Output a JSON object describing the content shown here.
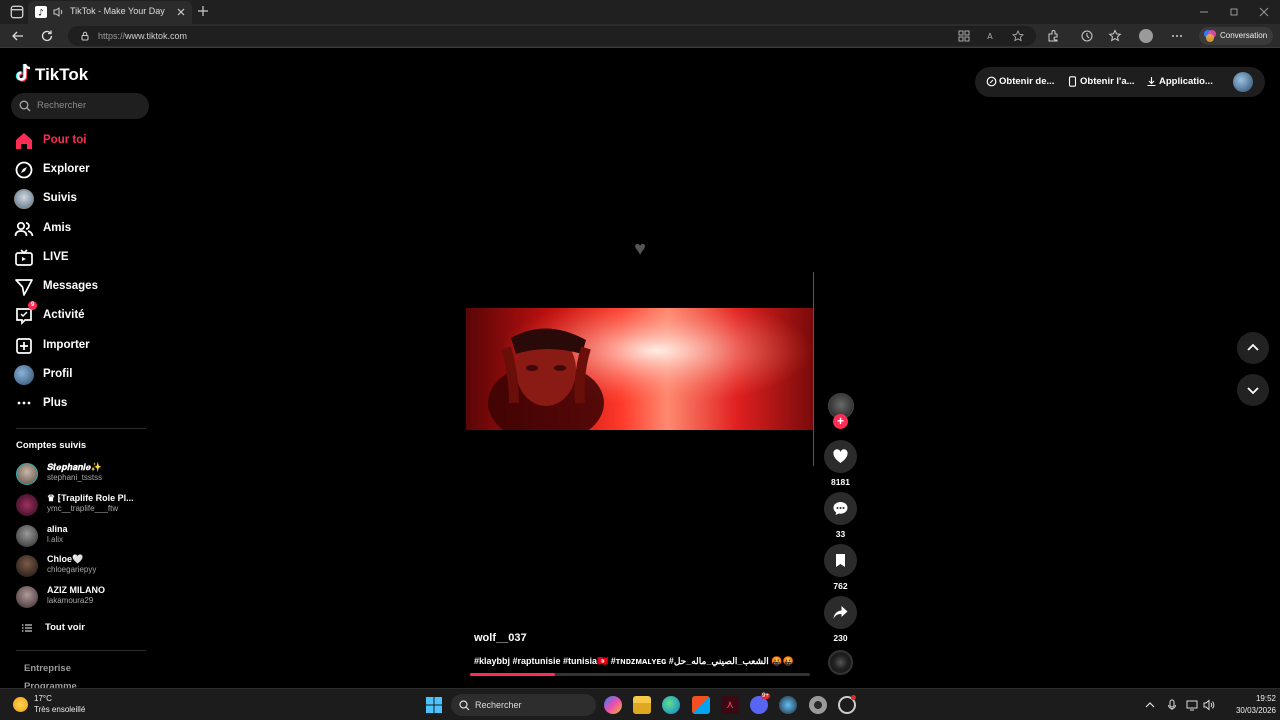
{
  "browser": {
    "tab_title": "TikTok - Make Your Day",
    "url_scheme": "https://",
    "url_host": "www.tiktok.com",
    "conversation_label": "Conversation"
  },
  "sidebar": {
    "logo": "TikTok",
    "search_placeholder": "Rechercher",
    "nav": [
      {
        "label": "Pour toi",
        "icon": "home-icon",
        "active": true
      },
      {
        "label": "Explorer",
        "icon": "compass-icon"
      },
      {
        "label": "Suivis",
        "icon": "following-avatar-icon"
      },
      {
        "label": "Amis",
        "icon": "friends-icon"
      },
      {
        "label": "LIVE",
        "icon": "live-tv-icon"
      },
      {
        "label": "Messages",
        "icon": "send-icon"
      },
      {
        "label": "Activité",
        "icon": "activity-icon",
        "badge": "9"
      },
      {
        "label": "Importer",
        "icon": "upload-plus-icon"
      },
      {
        "label": "Profil",
        "icon": "profile-avatar-icon"
      },
      {
        "label": "Plus",
        "icon": "more-dots-icon"
      }
    ],
    "followed_title": "Comptes suivis",
    "accounts": [
      {
        "name": "𝑺𝒕𝒆𝒑𝒉𝒂𝒏𝒊𝒆✨",
        "handle": "stephani_tsstss",
        "color": "#8a7a6a"
      },
      {
        "name": "♛ ⁅Traplife Role Pl...",
        "handle": "ymc__traplife___ftw",
        "color": "#5a1f3a"
      },
      {
        "name": "alina",
        "handle": "l.alix",
        "color": "#6a6a6a"
      },
      {
        "name": "Chloe🤍",
        "handle": "chloegariepyy",
        "color": "#4a3a30"
      },
      {
        "name": "AZIZ MILANO",
        "handle": "lakamoura29",
        "color": "#7a6a6a"
      }
    ],
    "see_all": "Tout voir",
    "footer": [
      "Entreprise",
      "Programme"
    ]
  },
  "header": {
    "pills": [
      "Obtenir de...",
      "Obtenir l'a...",
      "Applicatio..."
    ]
  },
  "video": {
    "author": "wolf__037",
    "caption": "#klaybbj #raptunisie #tunisia🇹🇳 #ᴛɴᴅᴢᴍᴀʟʏᴇɢ #الشعب_الصيني_ماله_حل 🤬🤬",
    "progress": 0.25,
    "likes": "8181",
    "comments": "33",
    "saves": "762",
    "shares": "230"
  },
  "taskbar": {
    "temperature": "17°C",
    "weather": "Très ensoleillé",
    "search_label": "Rechercher",
    "time": "19:52",
    "date": "30/03/2026",
    "discord_badge": "9+"
  }
}
